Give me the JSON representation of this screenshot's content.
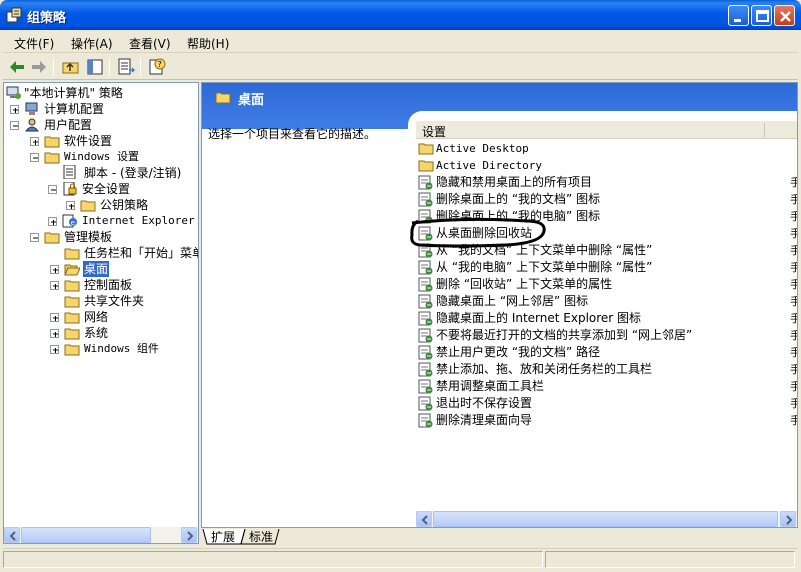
{
  "window": {
    "title": "组策略"
  },
  "menu": [
    "文件(F)",
    "操作(A)",
    "查看(V)",
    "帮助(H)"
  ],
  "tree": {
    "root": "\"本地计算机\" 策略",
    "computer_config": "计算机配置",
    "user_config": "用户配置",
    "software": "软件设置",
    "windows_settings": "Windows 设置",
    "scripts": "脚本 - (登录/注销)",
    "security": "安全设置",
    "public_key": "公钥策略",
    "ie": "Internet Explorer 维",
    "admin_templates": "管理模板",
    "taskbar": "任务栏和「开始」菜单",
    "desktop": "桌面",
    "control_panel": "控制面板",
    "shared_folders": "共享文件夹",
    "network": "网络",
    "system": "系统",
    "windows_components": "Windows 组件"
  },
  "right": {
    "title": "桌面",
    "description": "选择一个项目来查看它的描述。",
    "column_setting": "设置",
    "column_state_fragment": "手",
    "items": [
      "Active Desktop",
      "Active Directory",
      "隐藏和禁用桌面上的所有项目",
      "删除桌面上的 “我的文档” 图标",
      "删除桌面上的 “我的电脑” 图标",
      "从桌面删除回收站",
      "从 “我的文档” 上下文菜单中删除 “属性”",
      "从 “我的电脑” 上下文菜单中删除 “属性”",
      "删除 “回收站” 上下文菜单的属性",
      "隐藏桌面上 “网上邻居” 图标",
      "隐藏桌面上的 Internet Explorer 图标",
      "不要将最近打开的文档的共享添加到 “网上邻居”",
      "禁止用户更改 “我的文档” 路径",
      "禁止添加、拖、放和关闭任务栏的工具栏",
      "禁用调整桌面工具栏",
      "退出时不保存设置",
      "删除清理桌面向导"
    ]
  },
  "tabs": [
    "扩展",
    "标准"
  ],
  "colors": {
    "title_blue": "#0054e3",
    "selection": "#316ac5",
    "annotation_ink": "#000000"
  }
}
